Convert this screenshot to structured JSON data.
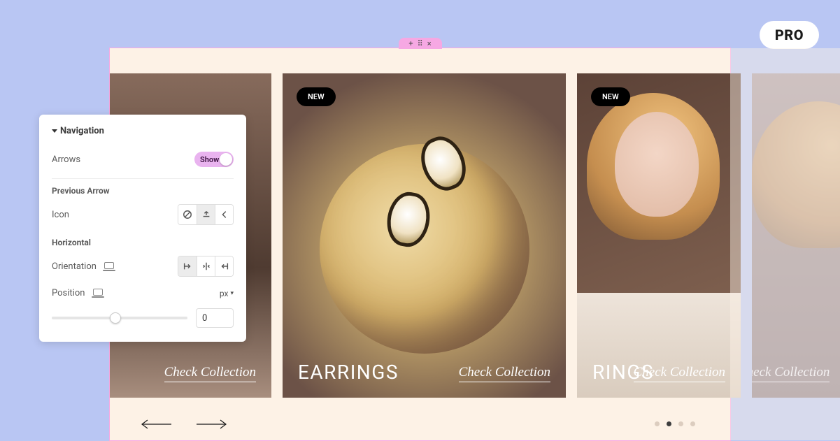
{
  "pro_label": "PRO",
  "handle": {
    "plus": "+",
    "grip": "⠿",
    "close": "×"
  },
  "slides": [
    {
      "title": "",
      "link": "Check Collection",
      "badge": ""
    },
    {
      "title": "EARRINGS",
      "link": "Check Collection",
      "badge": "NEW"
    },
    {
      "title": "RINGS",
      "link": "Check Collection",
      "badge": "NEW"
    },
    {
      "title": "",
      "link": "Check Collection",
      "badge": ""
    }
  ],
  "panel": {
    "section": "Navigation",
    "arrows_label": "Arrows",
    "toggle_text": "Show",
    "prev_heading": "Previous Arrow",
    "icon_label": "Icon",
    "horiz_heading": "Horizontal",
    "orientation_label": "Orientation",
    "position_label": "Position",
    "unit": "px",
    "position_value": "0"
  }
}
